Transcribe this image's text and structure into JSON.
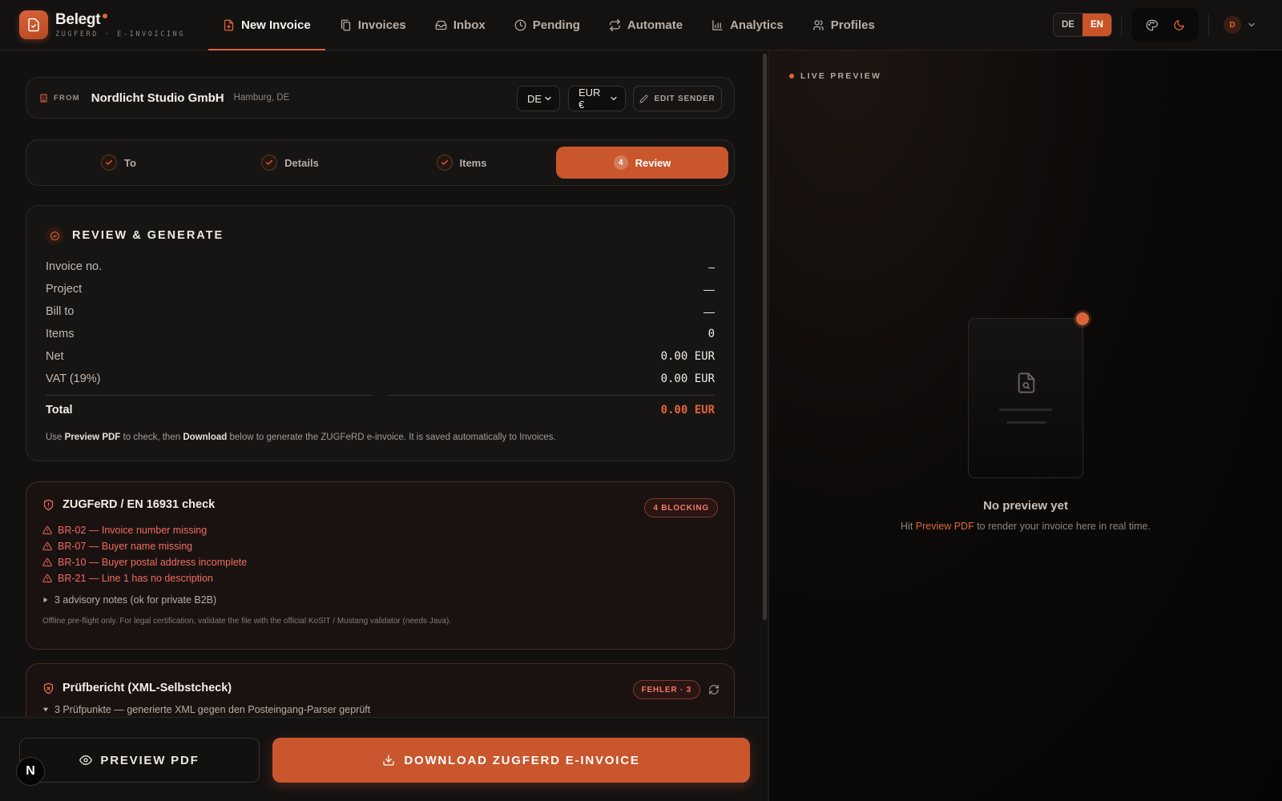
{
  "brand": {
    "name": "Belegt",
    "subtitle": "ZUGFERD · E-INVOICING"
  },
  "nav": [
    {
      "label": "New Invoice",
      "icon": "file-plus-icon",
      "active": true
    },
    {
      "label": "Invoices",
      "icon": "files-icon"
    },
    {
      "label": "Inbox",
      "icon": "inbox-icon"
    },
    {
      "label": "Pending",
      "icon": "clock-icon"
    },
    {
      "label": "Automate",
      "icon": "repeat-icon"
    },
    {
      "label": "Analytics",
      "icon": "bar-chart-icon"
    },
    {
      "label": "Profiles",
      "icon": "users-icon"
    }
  ],
  "language": {
    "options": [
      "DE",
      "EN"
    ],
    "selected": "EN"
  },
  "user": {
    "initial": "D"
  },
  "sender": {
    "from_label": "FROM",
    "name": "Nordlicht Studio GmbH",
    "location": "Hamburg, DE",
    "country_select": "DE",
    "currency_select": "EUR €",
    "edit_label": "EDIT SENDER"
  },
  "steps": [
    {
      "label": "To",
      "state": "done"
    },
    {
      "label": "Details",
      "state": "done"
    },
    {
      "label": "Items",
      "state": "done"
    },
    {
      "label": "Review",
      "number": "4",
      "state": "active"
    }
  ],
  "review": {
    "title": "REVIEW & GENERATE",
    "rows": [
      {
        "label": "Invoice no.",
        "value": "–"
      },
      {
        "label": "Project",
        "value": "—"
      },
      {
        "label": "Bill to",
        "value": "—"
      },
      {
        "label": "Items",
        "value": "0"
      },
      {
        "label": "Net",
        "value": "0.00 EUR"
      },
      {
        "label": "VAT (19%)",
        "value": "0.00 EUR"
      }
    ],
    "total_label": "Total",
    "total_value": "0.00 EUR",
    "note_pre": "Use ",
    "note_b1": "Preview PDF",
    "note_mid": " to check, then ",
    "note_b2": "Download",
    "note_post": " below to generate the ZUGFeRD e-invoice. It is saved automatically to Invoices."
  },
  "check": {
    "title": "ZUGFeRD / EN 16931 check",
    "badge": "4 BLOCKING",
    "issues": [
      "BR-02 — Invoice number missing",
      "BR-07 — Buyer name missing",
      "BR-10 — Buyer postal address incomplete",
      "BR-21 — Line 1 has no description"
    ],
    "advisory": "3 advisory notes (ok for private B2B)",
    "footnote": "Offline pre-flight only. For legal certification, validate the file with the official KoSIT / Mustang validator (needs Java)."
  },
  "pruef": {
    "title": "Prüfbericht (XML-Selbstcheck)",
    "badge": "FEHLER · 3",
    "summary": "3 Prüfpunkte — generierte XML gegen den Posteingang-Parser geprüft"
  },
  "actions": {
    "preview": "PREVIEW PDF",
    "download": "DOWNLOAD ZUGFERD E-INVOICE"
  },
  "preview_panel": {
    "label": "LIVE PREVIEW",
    "empty_title": "No preview yet",
    "empty_pre": "Hit ",
    "empty_link": "Preview PDF",
    "empty_post": " to render your invoice here in real time."
  },
  "dev_badge": "N",
  "colors": {
    "accent": "#c9562c",
    "error": "#f06d5e",
    "bg": "#121110"
  }
}
